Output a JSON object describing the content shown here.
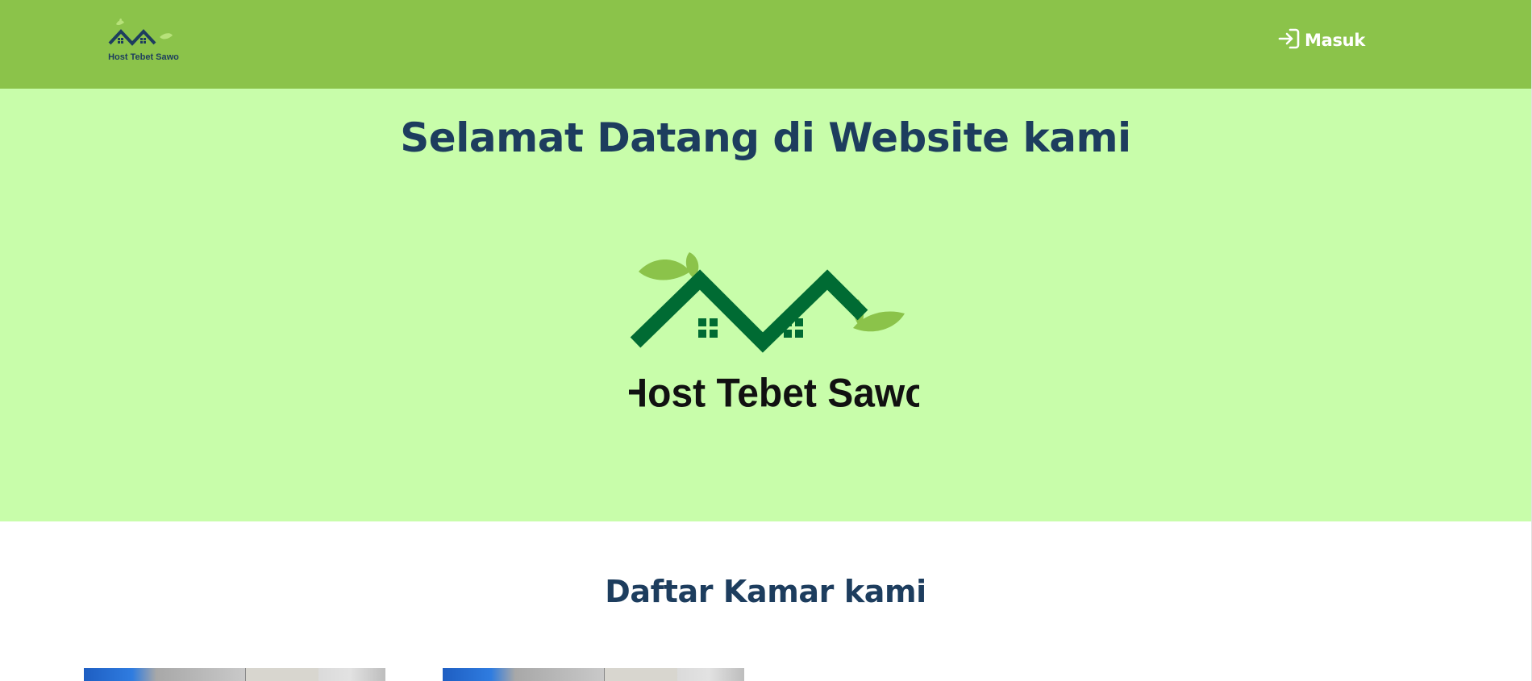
{
  "brand": {
    "name": "Host Tebet Sawo",
    "colors": {
      "navbar": "#8bc34a",
      "hero_bg": "#c8fdaa",
      "heading": "#1d3d5e",
      "roof_nav": "#1d3d5e",
      "roof_hero": "#006b33",
      "leaf": "#8bc34a"
    }
  },
  "nav": {
    "login_icon": "login-arrow-icon",
    "login_label": "Masuk"
  },
  "hero": {
    "title": "Selamat Datang di Website kami"
  },
  "rooms": {
    "title": "Daftar Kamar kami",
    "cards": [
      {
        "image": "room-photo"
      },
      {
        "image": "room-photo"
      }
    ]
  }
}
